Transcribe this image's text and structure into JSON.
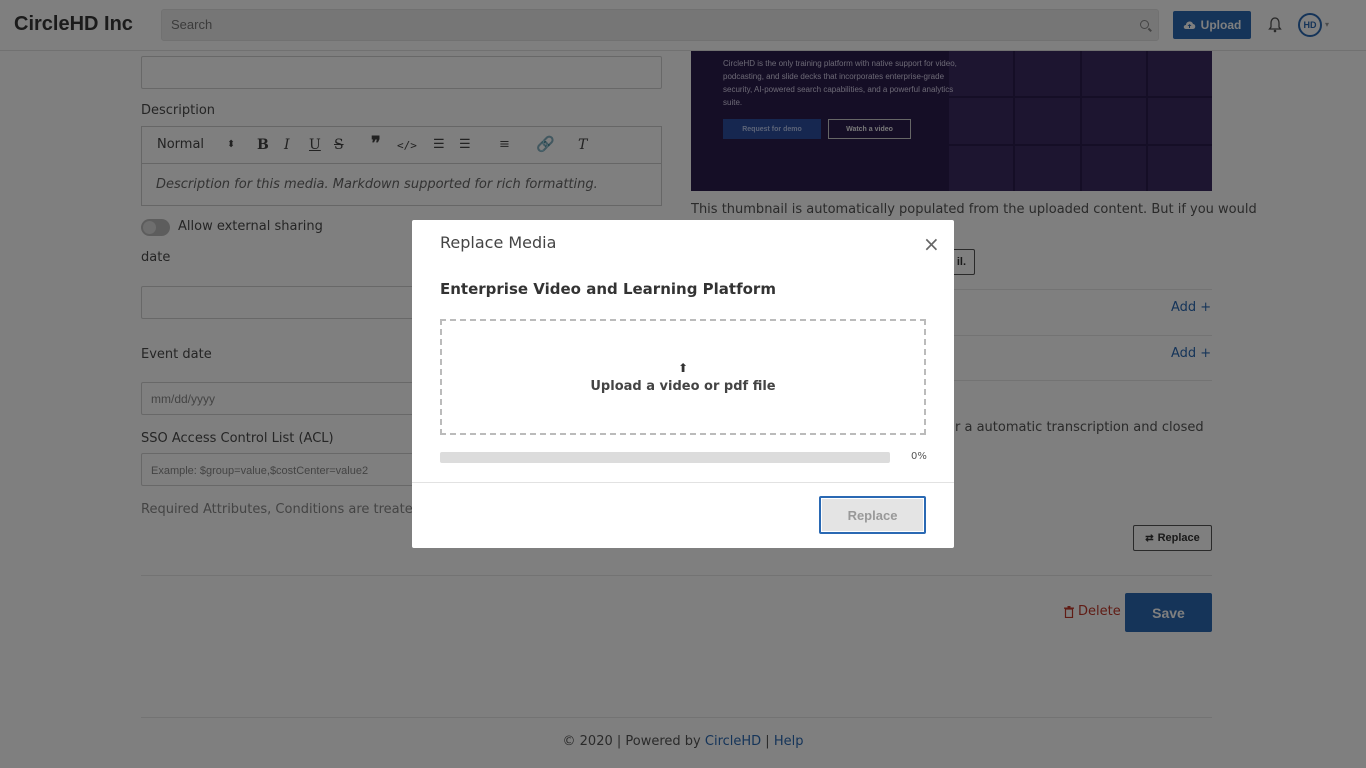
{
  "header": {
    "brand": "CircleHD Inc",
    "search_placeholder": "Search",
    "upload_label": "Upload",
    "avatar_initials": "HD"
  },
  "form": {
    "description_label": "Description",
    "format_select": "Normal",
    "description_placeholder": "Description for this media. Markdown supported for rich formatting.",
    "external_sharing_label": "Allow external sharing",
    "date_label": "date",
    "event_date_label": "Event date",
    "event_date_placeholder": "mm/dd/yyyy",
    "acl_label": "SSO Access Control List (ACL)",
    "acl_placeholder": "Example: $group=value,$costCenter=value2",
    "acl_help": "Required Attributes, Conditions are treated wi"
  },
  "thumbnail": {
    "text": "CircleHD is the only training platform with native support for video, podcasting, and slide decks that incorporates enterprise-grade security, AI-powered search capabilities, and a powerful analytics suite.",
    "demo_button": "Request for demo",
    "video_button": "Watch a video",
    "help_text": "This thumbnail is automatically populated from the uploaded content. But if you would",
    "small_button": "il."
  },
  "right": {
    "add_1": "Add +",
    "add_2": "Add +",
    "transcription_text": "r a automatic transcription and closed",
    "replace_label": "Replace"
  },
  "actions": {
    "delete_label": "Delete",
    "save_label": "Save"
  },
  "footer": {
    "copyright": "© 2020 | Powered by ",
    "brand_link": "CircleHD",
    "separator": " | ",
    "help_link": "Help"
  },
  "modal": {
    "title": "Replace Media",
    "close": "×",
    "media_title": "Enterprise Video and Learning Platform",
    "dropzone_icon": "⬆",
    "dropzone_text": "Upload a video or pdf file",
    "progress_value": 0,
    "progress_text": "0%",
    "replace_button": "Replace"
  }
}
